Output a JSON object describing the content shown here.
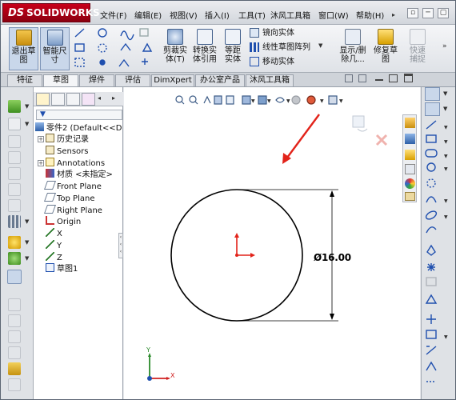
{
  "app": {
    "logo_prefix": "DS",
    "logo_name": "SOLIDWORKS"
  },
  "menu": [
    "文件(F)",
    "编辑(E)",
    "视图(V)",
    "插入(I)",
    "工具(T)",
    "沐风工具箱",
    "窗口(W)",
    "帮助(H)"
  ],
  "window_buttons": [
    "▫",
    "─",
    "▢",
    "✕"
  ],
  "commands": {
    "exit_sketch": "退出草图",
    "smart_dim": "智能尺寸",
    "trim": "剪裁实体(T)",
    "convert": "转换实体引用",
    "offset": "等距实体",
    "mirror": "镜向实体",
    "linear_pattern": "线性草图阵列",
    "move": "移动实体",
    "display_delete": "显示/删除几...",
    "repair": "修复草图",
    "quick_snap": "快速捕捉"
  },
  "tabs": [
    "特征",
    "草图",
    "焊件",
    "评估",
    "DimXpert",
    "办公室产品",
    "沐风工具箱"
  ],
  "active_tab": "草图",
  "tree": {
    "root": "零件2 (Default<<D",
    "items": [
      {
        "label": "历史记录",
        "expand": true
      },
      {
        "label": "Sensors",
        "expand": false
      },
      {
        "label": "Annotations",
        "expand": true
      },
      {
        "label": "材质 <未指定>",
        "expand": false
      },
      {
        "label": "Front Plane",
        "expand": false
      },
      {
        "label": "Top Plane",
        "expand": false
      },
      {
        "label": "Right Plane",
        "expand": false
      },
      {
        "label": "Origin",
        "expand": false
      },
      {
        "label": "X",
        "expand": false
      },
      {
        "label": "Y",
        "expand": false
      },
      {
        "label": "Z",
        "expand": false
      },
      {
        "label": "草图1",
        "expand": false
      }
    ]
  },
  "graphics": {
    "dimension": "Ø16.00",
    "triad_x": "X",
    "triad_y": "Y"
  },
  "colors": {
    "arrow": "#e2231a",
    "sketch": "#000000",
    "origin": "#e2231a",
    "accent": "#c8001a"
  }
}
